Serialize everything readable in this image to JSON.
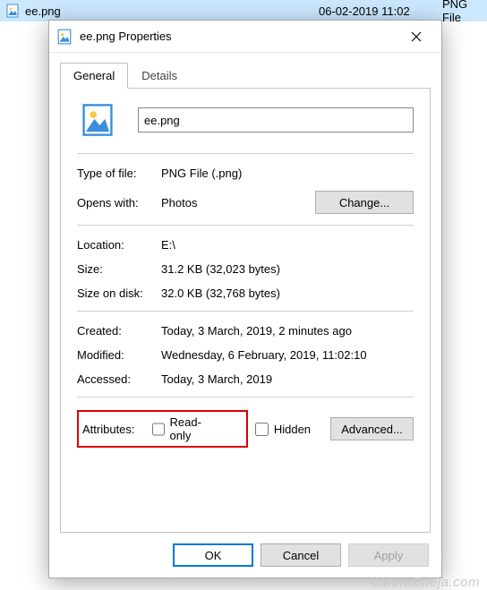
{
  "background_row": {
    "filename": "ee.png",
    "date": "06-02-2019 11:02",
    "filetype": "PNG File"
  },
  "dialog": {
    "title": "ee.png Properties",
    "tabs": {
      "general": "General",
      "details": "Details"
    },
    "filename_value": "ee.png",
    "fields": {
      "type_label": "Type of file:",
      "type_value": "PNG File (.png)",
      "opens_label": "Opens with:",
      "opens_value": "Photos",
      "change_btn": "Change...",
      "location_label": "Location:",
      "location_value": "E:\\",
      "size_label": "Size:",
      "size_value": "31.2 KB (32,023 bytes)",
      "sod_label": "Size on disk:",
      "sod_value": "32.0 KB (32,768 bytes)",
      "created_label": "Created:",
      "created_value": "Today, 3 March, 2019, 2 minutes ago",
      "modified_label": "Modified:",
      "modified_value": "Wednesday, 6 February, 2019, 11:02:10",
      "accessed_label": "Accessed:",
      "accessed_value": "Today, 3 March, 2019",
      "attributes_label": "Attributes:",
      "readonly_label": "Read-only",
      "hidden_label": "Hidden",
      "advanced_btn": "Advanced..."
    },
    "buttons": {
      "ok": "OK",
      "cancel": "Cancel",
      "apply": "Apply"
    }
  },
  "watermark": "©MeraBheja.com"
}
